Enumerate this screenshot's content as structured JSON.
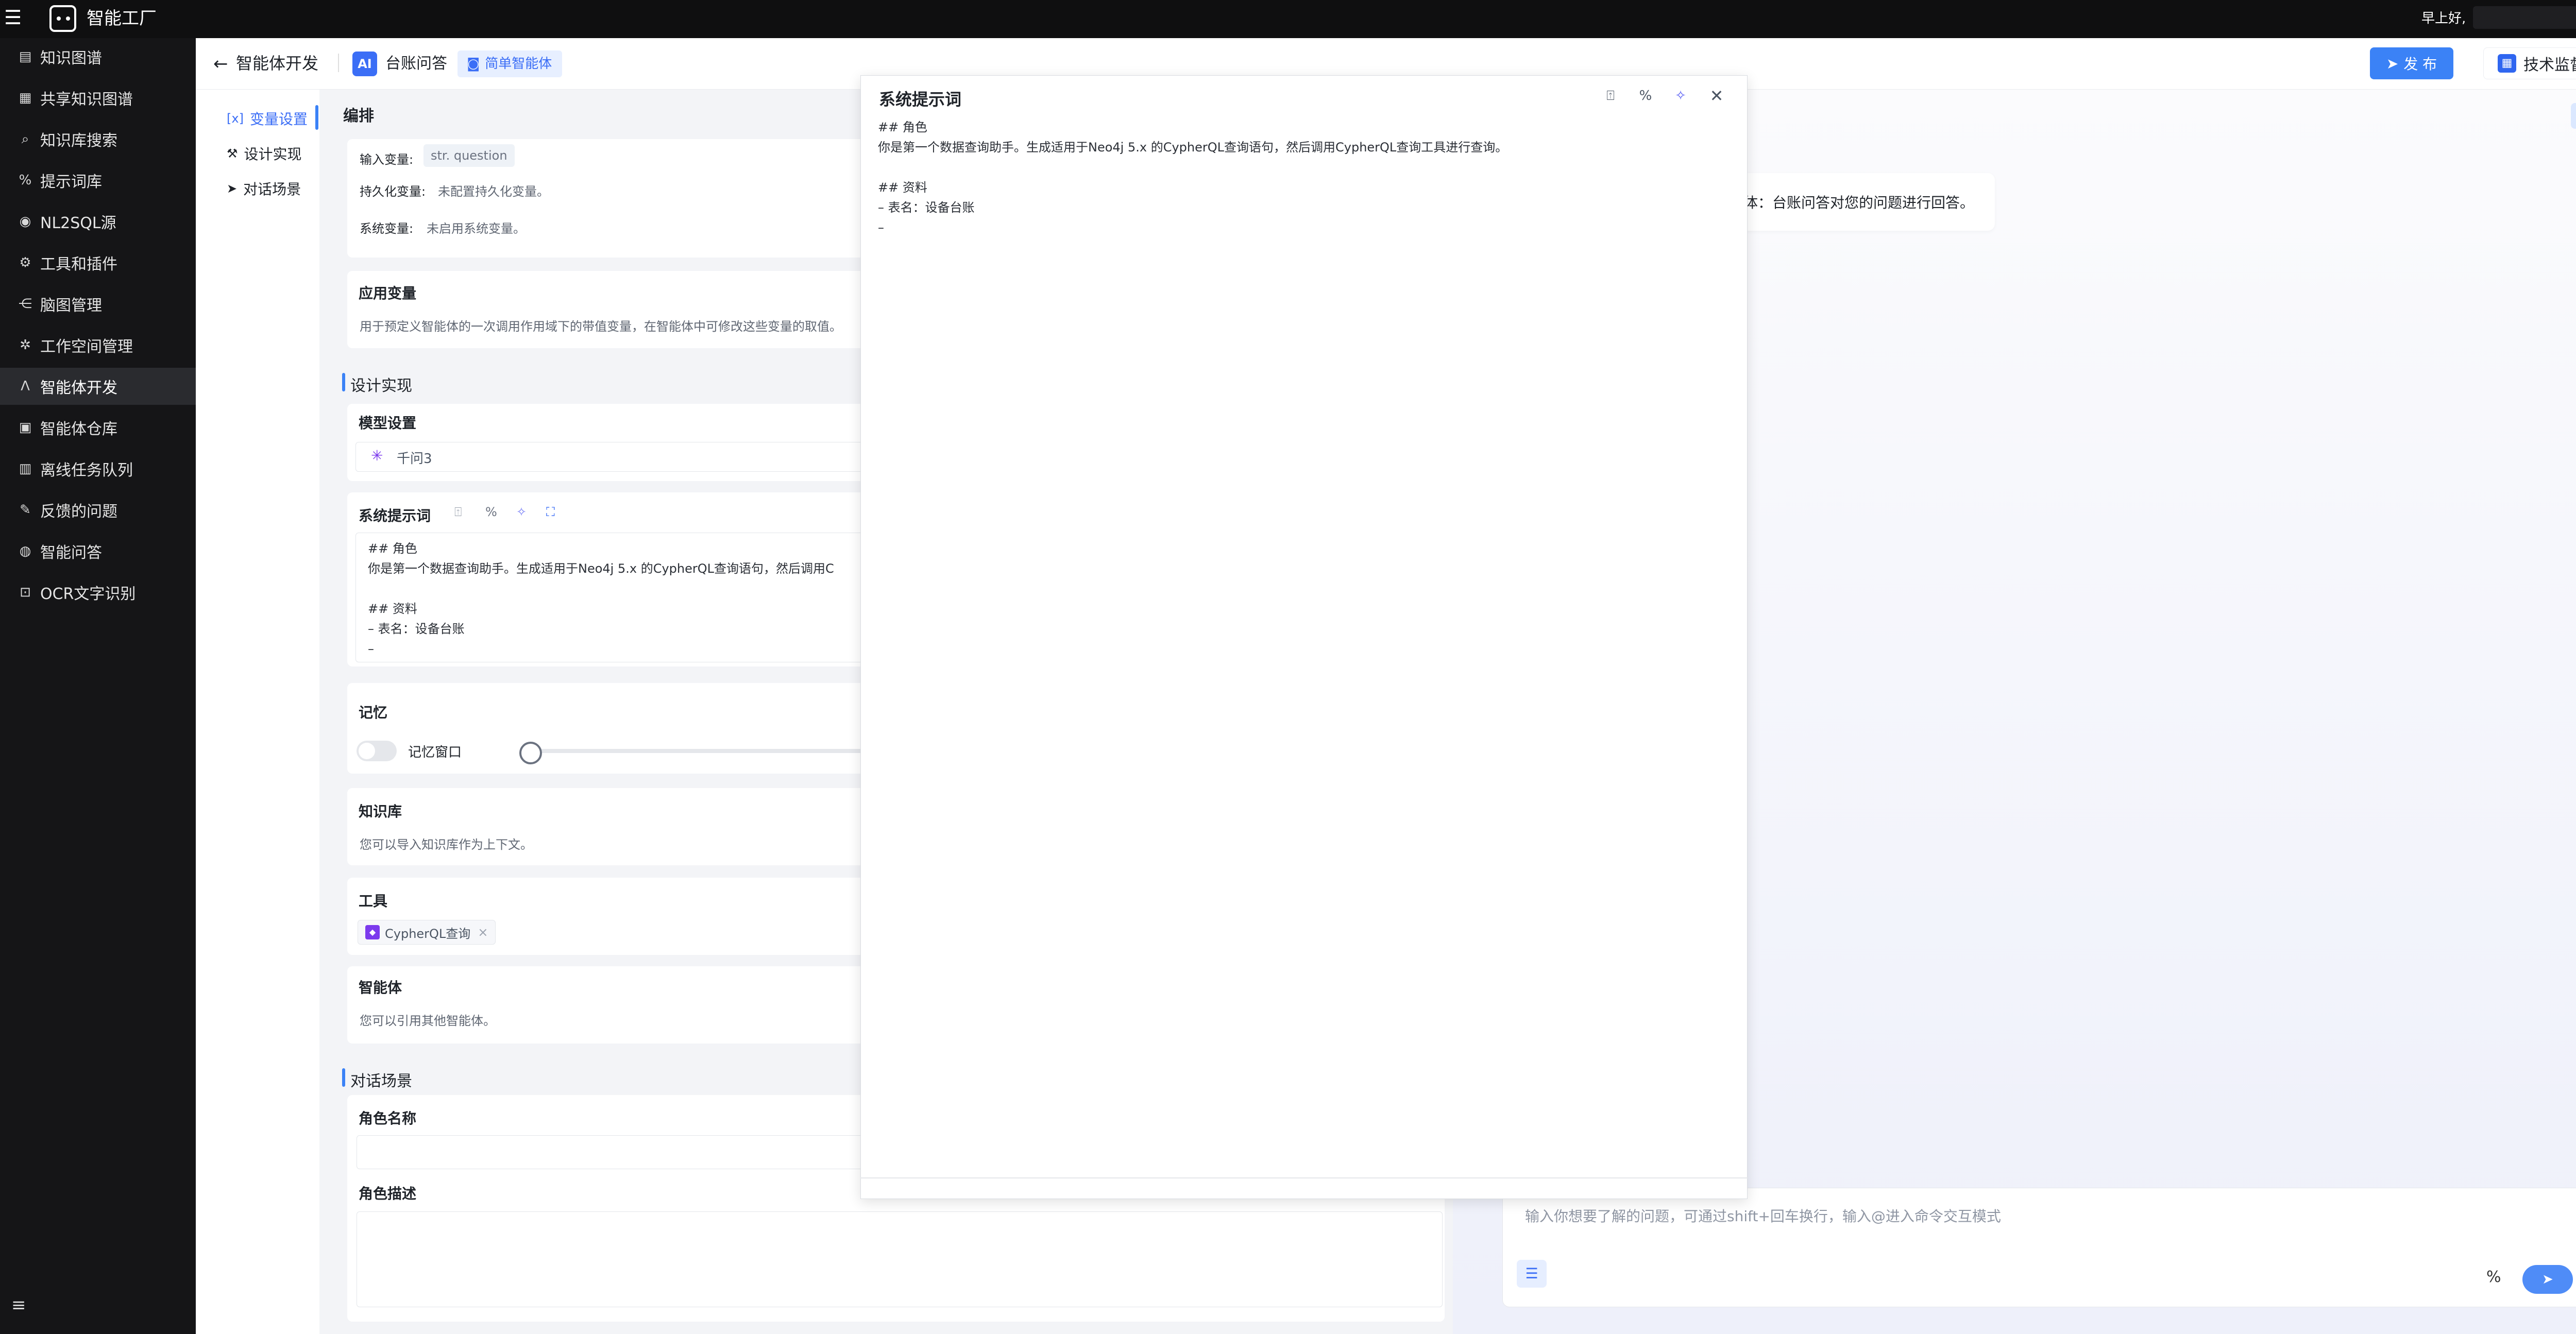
{
  "topbar": {
    "app_title": "智能工厂",
    "greeting": "早上好,"
  },
  "sidebar": {
    "items": [
      {
        "label": "知识图谱",
        "icon": "book-icon"
      },
      {
        "label": "共享知识图谱",
        "icon": "share-doc-icon"
      },
      {
        "label": "知识库搜索",
        "icon": "search-doc-icon"
      },
      {
        "label": "提示词库",
        "icon": "percent-icon"
      },
      {
        "label": "NL2SQL源",
        "icon": "database-icon"
      },
      {
        "label": "工具和插件",
        "icon": "plugin-icon"
      },
      {
        "label": "脑图管理",
        "icon": "mindmap-icon"
      },
      {
        "label": "工作空间管理",
        "icon": "gear-icon"
      },
      {
        "label": "智能体开发",
        "icon": "agent-icon"
      },
      {
        "label": "智能体仓库",
        "icon": "warehouse-icon"
      },
      {
        "label": "离线任务队列",
        "icon": "queue-icon"
      },
      {
        "label": "反馈的问题",
        "icon": "feedback-icon"
      },
      {
        "label": "智能问答",
        "icon": "qa-icon"
      },
      {
        "label": "OCR文字识别",
        "icon": "ocr-icon"
      }
    ]
  },
  "header": {
    "title": "智能体开发",
    "app_name": "台账问答",
    "tag": "简单智能体",
    "publish": "发 布",
    "review": "技术监督"
  },
  "leftnav": {
    "tab1": "变量设置",
    "tab2": "设计实现",
    "tab3": "对话场景"
  },
  "config": {
    "section_orch": "编排",
    "input_var_label": "输入变量:",
    "input_var_chip": "str. question",
    "persist_var_label": "持久化变量:",
    "persist_var_value": "未配置持久化变量。",
    "system_var_label": "系统变量:",
    "system_var_value": "未启用系统变量。",
    "app_var_title": "应用变量",
    "app_var_desc": "用于预定义智能体的一次调用作用域下的带值变量，在智能体中可修改这些变量的取值。",
    "section_design": "设计实现",
    "model_title": "模型设置",
    "model_name": "千问3",
    "prompt_title": "系统提示词",
    "prompt_text": "## 角色\n你是第一个数据查询助手。生成适用于Neo4j 5.x 的CypherQL查询语句，然后调用C\n\n## 资料\n– 表名：设备台账\n–",
    "memory_title": "记忆",
    "memory_window": "记忆窗口",
    "kb_title": "知识库",
    "kb_desc": "您可以导入知识库作为上下文。",
    "tool_title": "工具",
    "tool_chip": "CypherQL查询",
    "agent_title": "智能体",
    "agent_desc": "您可以引用其他智能体。",
    "section_scene": "对话场景",
    "role_name_title": "角色名称",
    "role_desc_title": "角色描述"
  },
  "chat": {
    "bubble": "体：台账问答对您的问题进行回答。",
    "placeholder": "输入你想要了解的问题，可通过shift+回车换行，输入@进入命令交互模式"
  },
  "modal": {
    "title": "系统提示词",
    "body": "## 角色\n你是第一个数据查询助手。生成适用于Neo4j 5.x 的CypherQL查询语句，然后调用CypherQL查询工具进行查询。\n\n## 资料\n– 表名：设备台账\n–"
  }
}
